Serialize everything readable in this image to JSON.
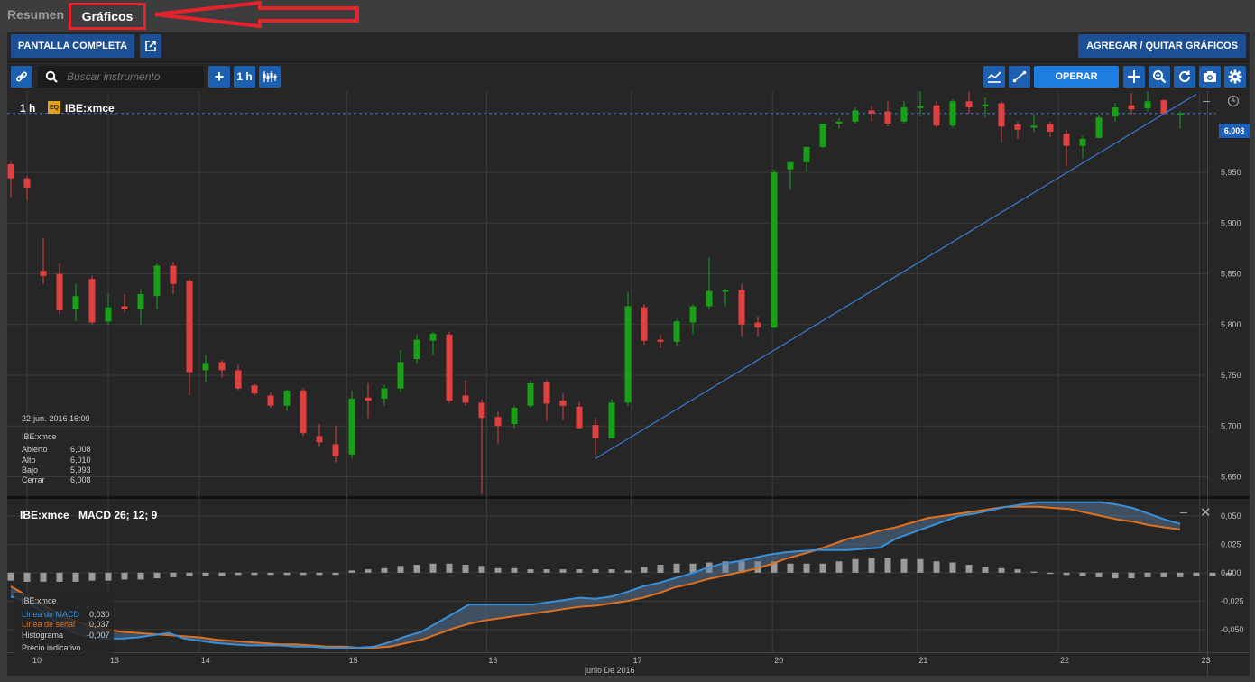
{
  "tabs": {
    "resumen": "Resumen",
    "graficos": "Gráficos"
  },
  "toolbar": {
    "fullscreen": "PANTALLA COMPLETA",
    "add_remove": "AGREGAR / QUITAR GRÁFICOS",
    "search_placeholder": "Buscar instrumento",
    "interval": "1 h",
    "operar": "OPERAR"
  },
  "main_chart": {
    "interval": "1 h",
    "badge": "EQ",
    "symbol": "IBE:xmce",
    "last_price_label": "6,008",
    "y_ticks": [
      "5,950",
      "5,900",
      "5,850",
      "5,800",
      "5,750",
      "5,700",
      "5,650"
    ],
    "info": {
      "date": "22-jun.-2016 16:00",
      "symbol": "IBE:xmce",
      "rows": [
        {
          "label": "Abierto",
          "value": "6,008"
        },
        {
          "label": "Alto",
          "value": "6,010"
        },
        {
          "label": "Bajo",
          "value": "5,993"
        },
        {
          "label": "Cerrar",
          "value": "6,008"
        }
      ]
    }
  },
  "macd_panel": {
    "symbol": "IBE:xmce",
    "title": "MACD 26; 12; 9",
    "y_ticks": [
      "0,050",
      "0,025",
      "0,000",
      "-0,025",
      "-0,050"
    ],
    "legend_symbol": "IBE:xmce",
    "legend": [
      {
        "label": "Línea de MACD",
        "value": "0,030",
        "color": "#3b8fd9"
      },
      {
        "label": "Línea de señal",
        "value": "0,037",
        "color": "#e0701e"
      },
      {
        "label": "Histograma",
        "value": "-0,007",
        "color": "#cfcfcf"
      }
    ],
    "indicative": "Precio indicativo"
  },
  "x_axis": {
    "ticks": [
      "10",
      "13",
      "14",
      "15",
      "16",
      "17",
      "20",
      "21",
      "22",
      "23"
    ],
    "month_label": "junio De 2016"
  },
  "colors": {
    "up": "#18a018",
    "down": "#e04040",
    "trendline": "#3a7ad0",
    "accent": "#1e7de0"
  },
  "chart_data": {
    "type": "candlestick",
    "ylim": [
      5.63,
      6.03
    ],
    "candles": [
      {
        "o": 5.958,
        "h": 5.96,
        "c": 5.944,
        "l": 5.925
      },
      {
        "o": 5.944,
        "h": 5.946,
        "c": 5.935,
        "l": 5.922
      },
      {
        "o": 5.853,
        "h": 5.885,
        "c": 5.848,
        "l": 5.84
      },
      {
        "o": 5.85,
        "h": 5.86,
        "c": 5.814,
        "l": 5.81
      },
      {
        "o": 5.815,
        "h": 5.84,
        "c": 5.828,
        "l": 5.803
      },
      {
        "o": 5.845,
        "h": 5.848,
        "c": 5.802,
        "l": 5.8
      },
      {
        "o": 5.803,
        "h": 5.83,
        "c": 5.817,
        "l": 5.8
      },
      {
        "o": 5.818,
        "h": 5.83,
        "c": 5.815,
        "l": 5.812
      },
      {
        "o": 5.815,
        "h": 5.835,
        "c": 5.83,
        "l": 5.8
      },
      {
        "o": 5.828,
        "h": 5.86,
        "c": 5.858,
        "l": 5.815
      },
      {
        "o": 5.858,
        "h": 5.862,
        "c": 5.84,
        "l": 5.83
      },
      {
        "o": 5.843,
        "h": 5.845,
        "c": 5.753,
        "l": 5.73
      },
      {
        "o": 5.755,
        "h": 5.77,
        "c": 5.762,
        "l": 5.743
      },
      {
        "o": 5.763,
        "h": 5.765,
        "c": 5.755,
        "l": 5.748
      },
      {
        "o": 5.755,
        "h": 5.76,
        "c": 5.737,
        "l": 5.735
      },
      {
        "o": 5.74,
        "h": 5.742,
        "c": 5.732,
        "l": 5.73
      },
      {
        "o": 5.73,
        "h": 5.733,
        "c": 5.72,
        "l": 5.718
      },
      {
        "o": 5.72,
        "h": 5.736,
        "c": 5.735,
        "l": 5.715
      },
      {
        "o": 5.735,
        "h": 5.737,
        "c": 5.693,
        "l": 5.69
      },
      {
        "o": 5.69,
        "h": 5.702,
        "c": 5.684,
        "l": 5.68
      },
      {
        "o": 5.682,
        "h": 5.7,
        "c": 5.67,
        "l": 5.664
      },
      {
        "o": 5.672,
        "h": 5.735,
        "c": 5.727,
        "l": 5.668
      },
      {
        "o": 5.728,
        "h": 5.742,
        "c": 5.725,
        "l": 5.708
      },
      {
        "o": 5.727,
        "h": 5.74,
        "c": 5.737,
        "l": 5.72
      },
      {
        "o": 5.737,
        "h": 5.775,
        "c": 5.763,
        "l": 5.733
      },
      {
        "o": 5.766,
        "h": 5.79,
        "c": 5.785,
        "l": 5.762
      },
      {
        "o": 5.784,
        "h": 5.793,
        "c": 5.791,
        "l": 5.77
      },
      {
        "o": 5.79,
        "h": 5.793,
        "c": 5.725,
        "l": 5.723
      },
      {
        "o": 5.73,
        "h": 5.745,
        "c": 5.723,
        "l": 5.72
      },
      {
        "o": 5.723,
        "h": 5.726,
        "c": 5.708,
        "l": 5.633
      },
      {
        "o": 5.709,
        "h": 5.714,
        "c": 5.7,
        "l": 5.683
      },
      {
        "o": 5.702,
        "h": 5.72,
        "c": 5.718,
        "l": 5.698
      },
      {
        "o": 5.72,
        "h": 5.745,
        "c": 5.742,
        "l": 5.718
      },
      {
        "o": 5.743,
        "h": 5.745,
        "c": 5.722,
        "l": 5.705
      },
      {
        "o": 5.725,
        "h": 5.732,
        "c": 5.72,
        "l": 5.706
      },
      {
        "o": 5.719,
        "h": 5.724,
        "c": 5.698,
        "l": 5.697
      },
      {
        "o": 5.701,
        "h": 5.708,
        "c": 5.688,
        "l": 5.672
      },
      {
        "o": 5.688,
        "h": 5.726,
        "c": 5.723,
        "l": 5.688
      },
      {
        "o": 5.723,
        "h": 5.832,
        "c": 5.818,
        "l": 5.72
      },
      {
        "o": 5.817,
        "h": 5.82,
        "c": 5.784,
        "l": 5.78
      },
      {
        "o": 5.785,
        "h": 5.79,
        "c": 5.783,
        "l": 5.777
      },
      {
        "o": 5.783,
        "h": 5.805,
        "c": 5.803,
        "l": 5.779
      },
      {
        "o": 5.802,
        "h": 5.82,
        "c": 5.818,
        "l": 5.79
      },
      {
        "o": 5.818,
        "h": 5.866,
        "c": 5.833,
        "l": 5.815
      },
      {
        "o": 5.833,
        "h": 5.835,
        "c": 5.834,
        "l": 5.818
      },
      {
        "o": 5.834,
        "h": 5.84,
        "c": 5.8,
        "l": 5.788
      },
      {
        "o": 5.802,
        "h": 5.808,
        "c": 5.797,
        "l": 5.788
      },
      {
        "o": 5.797,
        "h": 5.953,
        "c": 5.95,
        "l": 5.796
      },
      {
        "o": 5.953,
        "h": 5.96,
        "c": 5.96,
        "l": 5.933
      },
      {
        "o": 5.96,
        "h": 5.975,
        "c": 5.975,
        "l": 5.95
      },
      {
        "o": 5.975,
        "h": 5.998,
        "c": 5.998,
        "l": 5.974
      },
      {
        "o": 5.998,
        "h": 6.003,
        "c": 6.0,
        "l": 5.993
      },
      {
        "o": 6.0,
        "h": 6.014,
        "c": 6.011,
        "l": 5.998
      },
      {
        "o": 6.011,
        "h": 6.016,
        "c": 6.008,
        "l": 6.0
      },
      {
        "o": 6.01,
        "h": 6.02,
        "c": 5.998,
        "l": 5.995
      },
      {
        "o": 6.0,
        "h": 6.02,
        "c": 6.014,
        "l": 5.998
      },
      {
        "o": 6.014,
        "h": 6.04,
        "c": 6.015,
        "l": 6.005
      },
      {
        "o": 6.016,
        "h": 6.02,
        "c": 5.996,
        "l": 5.994
      },
      {
        "o": 5.996,
        "h": 6.022,
        "c": 6.02,
        "l": 5.994
      },
      {
        "o": 6.02,
        "h": 6.03,
        "c": 6.014,
        "l": 6.008
      },
      {
        "o": 6.015,
        "h": 6.024,
        "c": 6.017,
        "l": 6.004
      },
      {
        "o": 6.018,
        "h": 6.02,
        "c": 5.995,
        "l": 5.98
      },
      {
        "o": 5.997,
        "h": 6.0,
        "c": 5.992,
        "l": 5.983
      },
      {
        "o": 5.994,
        "h": 6.008,
        "c": 5.996,
        "l": 5.99
      },
      {
        "o": 5.998,
        "h": 6.0,
        "c": 5.99,
        "l": 5.985
      },
      {
        "o": 5.988,
        "h": 5.992,
        "c": 5.976,
        "l": 5.956
      },
      {
        "o": 5.976,
        "h": 5.986,
        "c": 5.983,
        "l": 5.964
      },
      {
        "o": 5.984,
        "h": 6.006,
        "c": 6.004,
        "l": 5.983
      },
      {
        "o": 6.005,
        "h": 6.018,
        "c": 6.014,
        "l": 6.0
      },
      {
        "o": 6.016,
        "h": 6.028,
        "c": 6.012,
        "l": 6.006
      },
      {
        "o": 6.013,
        "h": 6.034,
        "c": 6.02,
        "l": 6.01
      },
      {
        "o": 6.021,
        "h": 6.022,
        "c": 6.008,
        "l": 6.006
      },
      {
        "o": 6.008,
        "h": 6.01,
        "c": 6.008,
        "l": 5.993
      }
    ],
    "trendline": {
      "start": {
        "x_index": 36,
        "y": 5.668
      },
      "end": {
        "x_index": 73,
        "y": 6.027
      }
    },
    "last_price": 6.008,
    "macd": {
      "ylim": [
        -0.07,
        0.065
      ],
      "macd_line": [
        -0.021,
        -0.025,
        -0.035,
        -0.045,
        -0.053,
        -0.057,
        -0.058,
        -0.058,
        -0.057,
        -0.055,
        -0.053,
        -0.058,
        -0.06,
        -0.062,
        -0.063,
        -0.064,
        -0.064,
        -0.064,
        -0.065,
        -0.065,
        -0.066,
        -0.066,
        -0.066,
        -0.065,
        -0.061,
        -0.056,
        -0.052,
        -0.044,
        -0.036,
        -0.028,
        -0.028,
        -0.028,
        -0.028,
        -0.028,
        -0.026,
        -0.024,
        -0.022,
        -0.023,
        -0.021,
        -0.017,
        -0.012,
        -0.009,
        -0.005,
        -0.001,
        0.004,
        0.008,
        0.01,
        0.013,
        0.016,
        0.018,
        0.019,
        0.02,
        0.02,
        0.02,
        0.021,
        0.022,
        0.03,
        0.035,
        0.04,
        0.045,
        0.05,
        0.052,
        0.055,
        0.058,
        0.06,
        0.062,
        0.062,
        0.062,
        0.062,
        0.062,
        0.06,
        0.057,
        0.052,
        0.047,
        0.043
      ],
      "signal_line": [
        -0.012,
        -0.02,
        -0.028,
        -0.036,
        -0.042,
        -0.047,
        -0.05,
        -0.052,
        -0.053,
        -0.054,
        -0.055,
        -0.056,
        -0.057,
        -0.059,
        -0.06,
        -0.061,
        -0.062,
        -0.063,
        -0.063,
        -0.064,
        -0.065,
        -0.065,
        -0.066,
        -0.066,
        -0.065,
        -0.062,
        -0.059,
        -0.054,
        -0.049,
        -0.045,
        -0.042,
        -0.04,
        -0.038,
        -0.036,
        -0.034,
        -0.032,
        -0.03,
        -0.029,
        -0.027,
        -0.025,
        -0.022,
        -0.018,
        -0.013,
        -0.01,
        -0.006,
        -0.003,
        0.0,
        0.003,
        0.007,
        0.012,
        0.016,
        0.02,
        0.025,
        0.03,
        0.033,
        0.037,
        0.04,
        0.044,
        0.048,
        0.05,
        0.052,
        0.054,
        0.056,
        0.058,
        0.058,
        0.058,
        0.057,
        0.056,
        0.053,
        0.05,
        0.047,
        0.045,
        0.042,
        0.04,
        0.038,
        0.037
      ],
      "histogram": [
        -0.007,
        -0.008,
        -0.008,
        -0.008,
        -0.008,
        -0.007,
        -0.007,
        -0.006,
        -0.006,
        -0.005,
        -0.004,
        -0.003,
        -0.003,
        -0.003,
        -0.002,
        -0.002,
        -0.002,
        -0.002,
        -0.002,
        -0.002,
        -0.002,
        0.002,
        0.003,
        0.004,
        0.006,
        0.007,
        0.008,
        0.008,
        0.007,
        0.006,
        0.004,
        0.004,
        0.003,
        0.003,
        0.003,
        0.003,
        0.003,
        0.003,
        0.002,
        0.005,
        0.007,
        0.008,
        0.008,
        0.009,
        0.01,
        0.01,
        0.01,
        0.01,
        0.008,
        0.008,
        0.008,
        0.01,
        0.012,
        0.013,
        0.013,
        0.012,
        0.012,
        0.01,
        0.009,
        0.007,
        0.005,
        0.004,
        0.003,
        0.001,
        -0.001,
        -0.002,
        -0.003,
        -0.004,
        -0.005,
        -0.005,
        -0.004,
        -0.004,
        -0.004,
        -0.003,
        -0.003,
        -0.002
      ]
    }
  }
}
